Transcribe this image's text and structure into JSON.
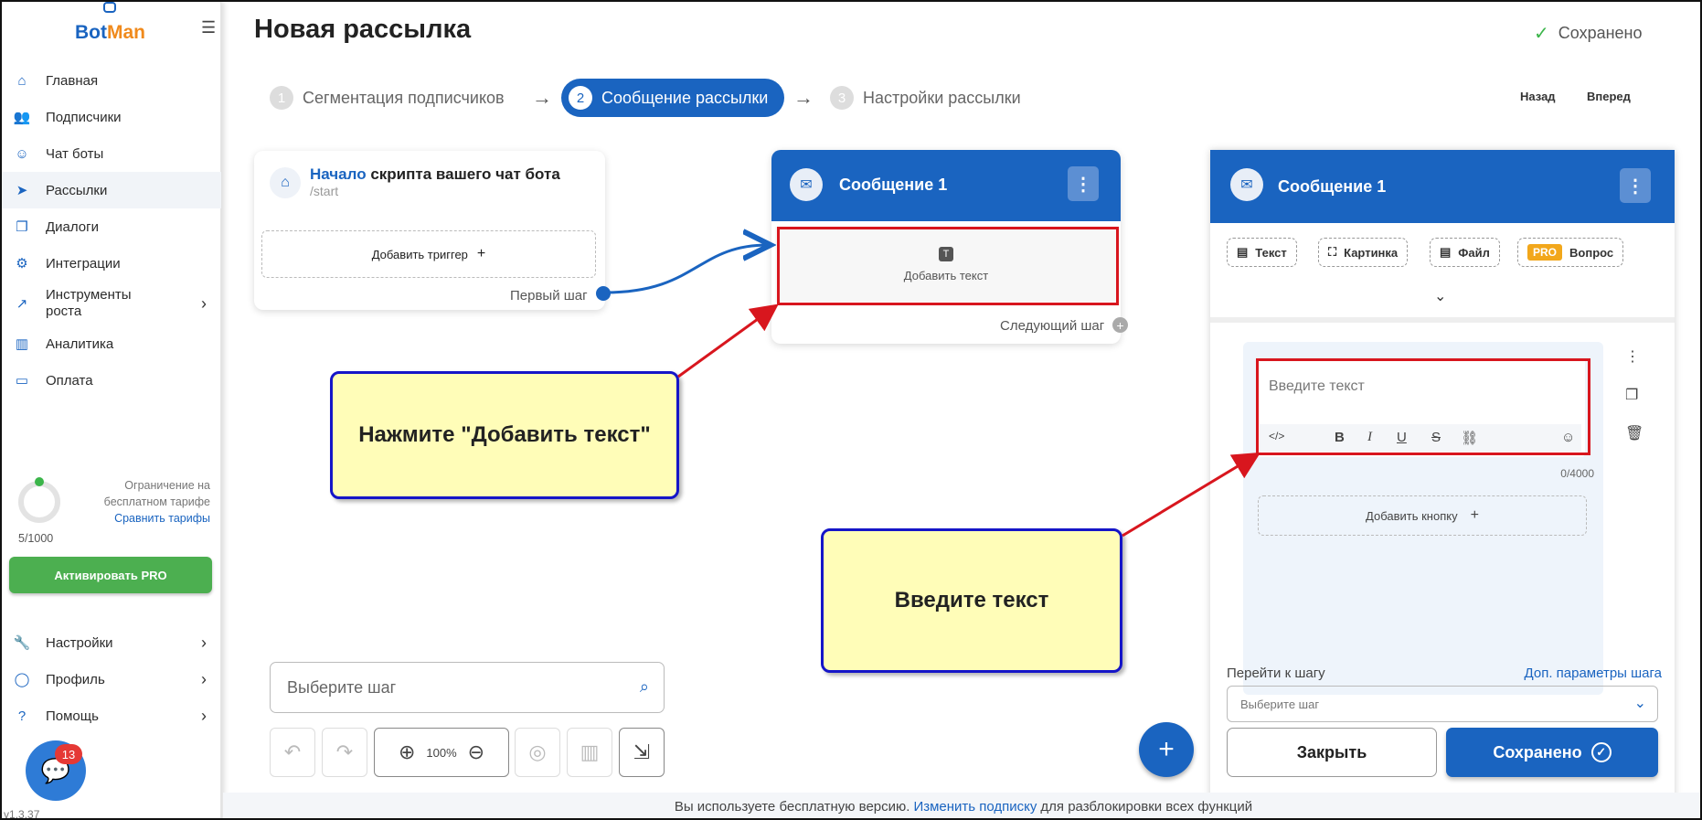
{
  "app": {
    "logo_bot": "Bot",
    "logo_man": "Man",
    "version": "v1.3.37"
  },
  "sidebar": {
    "items": [
      {
        "label": "Главная",
        "icon": "home-icon"
      },
      {
        "label": "Подписчики",
        "icon": "users-icon"
      },
      {
        "label": "Чат боты",
        "icon": "bot-icon"
      },
      {
        "label": "Рассылки",
        "icon": "send-icon"
      },
      {
        "label": "Диалоги",
        "icon": "dialogs-icon"
      },
      {
        "label": "Интеграции",
        "icon": "integrations-icon"
      },
      {
        "label": "Инструменты\nроста",
        "icon": "growth-icon"
      },
      {
        "label": "Аналитика",
        "icon": "analytics-icon"
      },
      {
        "label": "Оплата",
        "icon": "wallet-icon"
      }
    ],
    "limit": {
      "line1": "Ограничение на",
      "line2": "бесплатном тарифе",
      "compare_link": "Сравнить тарифы",
      "count": "5/1000"
    },
    "activate_pro": "Активировать PRO",
    "bottom_items": [
      {
        "label": "Настройки",
        "icon": "wrench-icon"
      },
      {
        "label": "Профиль",
        "icon": "profile-icon"
      },
      {
        "label": "Помощь",
        "icon": "help-icon"
      }
    ],
    "chat_badge": "13"
  },
  "header": {
    "title": "Новая рассылка",
    "saved_status": "Сохранено",
    "steps": [
      {
        "num": "1",
        "label": "Сегментация подписчиков"
      },
      {
        "num": "2",
        "label": "Сообщение рассылки"
      },
      {
        "num": "3",
        "label": "Настройки рассылки"
      }
    ],
    "back": "Назад",
    "forward": "Вперед"
  },
  "canvas": {
    "start": {
      "title_hl": "Начало",
      "title_rest": " скрипта вашего чат бота",
      "command": "/start",
      "add_trigger": "Добавить триггер",
      "first_step": "Первый шаг"
    },
    "message": {
      "title": "Сообщение 1",
      "add_text": "Добавить текст",
      "next_step": "Следующий шаг"
    },
    "search_placeholder": "Выберите шаг",
    "zoom": "100%"
  },
  "callouts": {
    "first": "Нажмите \"Добавить текст\"",
    "second": "Введите текст"
  },
  "panel": {
    "title": "Сообщение 1",
    "chips": {
      "text": "Текст",
      "image": "Картинка",
      "file": "Файл",
      "pro": "PRO",
      "question": "Вопрос"
    },
    "editor_placeholder": "Введите текст",
    "counter": "0/4000",
    "add_button": "Добавить кнопку",
    "goto_label": "Перейти к шагу",
    "more_params": "Доп. параметры шага",
    "select_placeholder": "Выберите шаг",
    "close": "Закрыть",
    "saved": "Сохранено"
  },
  "footer": {
    "pre": "Вы используете бесплатную версию.",
    "link": "Изменить подписку",
    "post": "для разблокировки всех функций"
  },
  "colors": {
    "brand_blue": "#1a64c0",
    "brand_orange": "#f08a1c",
    "pro_green": "#4caf50",
    "highlight_red": "#d8161e",
    "callout_yellow": "#fffdb8"
  }
}
